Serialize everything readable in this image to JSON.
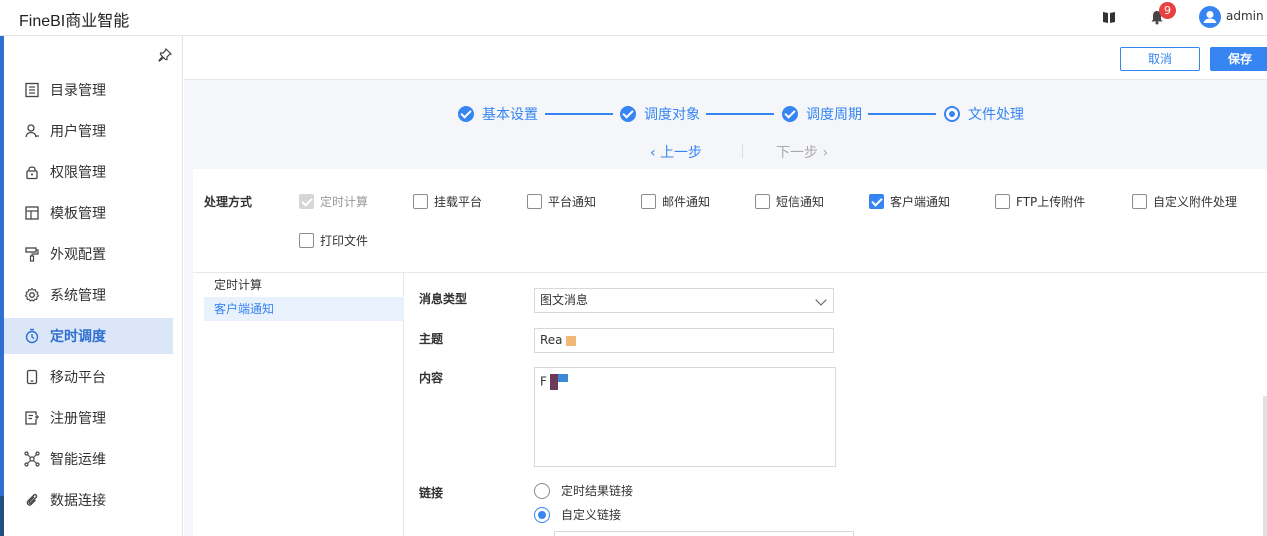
{
  "app": {
    "title": "FineBI商业智能"
  },
  "header": {
    "notification_count": "9",
    "username": "admin"
  },
  "sidebar": {
    "items": [
      {
        "label": "目录管理",
        "icon": "directory-icon"
      },
      {
        "label": "用户管理",
        "icon": "user-icon"
      },
      {
        "label": "权限管理",
        "icon": "lock-icon"
      },
      {
        "label": "模板管理",
        "icon": "template-icon"
      },
      {
        "label": "外观配置",
        "icon": "paint-roller-icon"
      },
      {
        "label": "系统管理",
        "icon": "gear-icon"
      },
      {
        "label": "定时调度",
        "icon": "timer-icon",
        "active": true
      },
      {
        "label": "移动平台",
        "icon": "mobile-icon"
      },
      {
        "label": "注册管理",
        "icon": "register-icon"
      },
      {
        "label": "智能运维",
        "icon": "network-icon"
      },
      {
        "label": "数据连接",
        "icon": "link-icon"
      }
    ]
  },
  "toolbar": {
    "cancel_label": "取消",
    "save_label": "保存"
  },
  "steps": [
    {
      "label": "基本设置",
      "state": "done"
    },
    {
      "label": "调度对象",
      "state": "done"
    },
    {
      "label": "调度周期",
      "state": "done"
    },
    {
      "label": "文件处理",
      "state": "current"
    }
  ],
  "step_nav": {
    "prev_label": "上一步",
    "next_label": "下一步"
  },
  "processing": {
    "label": "处理方式",
    "options": [
      {
        "label": "定时计算",
        "checked": true,
        "disabled": true
      },
      {
        "label": "挂载平台",
        "checked": false
      },
      {
        "label": "平台通知",
        "checked": false
      },
      {
        "label": "邮件通知",
        "checked": false
      },
      {
        "label": "短信通知",
        "checked": false
      },
      {
        "label": "客户端通知",
        "checked": true
      },
      {
        "label": "FTP上传附件",
        "checked": false
      },
      {
        "label": "自定义附件处理",
        "checked": false
      },
      {
        "label": "打印文件",
        "checked": false
      }
    ]
  },
  "subnav": {
    "items": [
      {
        "label": "定时计算"
      },
      {
        "label": "客户端通知",
        "active": true
      }
    ]
  },
  "form": {
    "message_type_label": "消息类型",
    "message_type_value": "图文消息",
    "subject_label": "主题",
    "subject_value": "Rea",
    "content_label": "内容",
    "content_value": "F",
    "link_label": "链接",
    "link_options": [
      {
        "label": "定时结果链接",
        "selected": false
      },
      {
        "label": "自定义链接",
        "selected": true
      }
    ]
  },
  "colors": {
    "accent": "#3685f2",
    "active_bg": "#dbe7f8",
    "badge": "#e64340"
  }
}
